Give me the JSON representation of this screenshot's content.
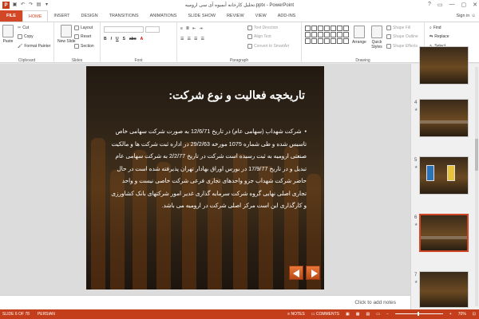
{
  "window": {
    "title": "تحلیل کارخانه آبمیوه آی سی ارومیه.pptx - PowerPoint",
    "app_icon": "P",
    "controls": [
      "?",
      "▭",
      "—",
      "▢",
      "✕"
    ]
  },
  "tabs": [
    {
      "label": "FILE"
    },
    {
      "label": "HOME"
    },
    {
      "label": "INSERT"
    },
    {
      "label": "DESIGN"
    },
    {
      "label": "TRANSITIONS"
    },
    {
      "label": "ANIMATIONS"
    },
    {
      "label": "SLIDE SHOW"
    },
    {
      "label": "REVIEW"
    },
    {
      "label": "VIEW"
    },
    {
      "label": "ADD-INS"
    }
  ],
  "signin": "Sign in",
  "ribbon": {
    "clipboard": {
      "label": "Clipboard",
      "paste": "Paste",
      "cut": "Cut",
      "copy": "Copy",
      "format_painter": "Format Painter"
    },
    "slides": {
      "label": "Slides",
      "new_slide": "New Slide",
      "layout": "Layout",
      "reset": "Reset",
      "section": "Section"
    },
    "font": {
      "label": "Font"
    },
    "paragraph": {
      "label": "Paragraph",
      "text_direction": "Text Direction",
      "align_text": "Align Text",
      "smartart": "Convert to SmartArt"
    },
    "drawing": {
      "label": "Drawing",
      "arrange": "Arrange",
      "quick_styles": "Quick Styles",
      "shape_fill": "Shape Fill",
      "shape_outline": "Shape Outline",
      "shape_effects": "Shape Effects"
    },
    "editing": {
      "label": "Editing",
      "find": "Find",
      "replace": "Replace",
      "select": "Select"
    }
  },
  "slide": {
    "title": "تاریخچه فعالیت و نوع شرکت:",
    "body": "شرکت شهداب (سهامی عام) در تاریخ 12/6/71 به صورت شرکت سهامی خاص تاسیس شده و طی شماره 1075 مورخه 29/2/63 در اداره ثبت شرکت ها و مالکیت صنعتی ارومیه به ثبت رسیده است شرکت در تاریخ 2/2/77 به شرکت سهامی عام تبدیل و در تاریخ 17/9/77 در بورس اوراق بهادار تهران پذیرفته شده است در حال حاضر شرکت شهداب جزو واحدهای تجاری فرعی شرکت خاصی نیست و واحد تجاری اصلی نهایی گروه شرکت سرمایه گذاری غدیر امور شرکتهای بانک کشاورزی و کارگذاری این است مرکز اصلی شرکت در ارومیه می باشد."
  },
  "notes_placeholder": "Click to add notes",
  "thumbnails": [
    {
      "num": "4"
    },
    {
      "num": "5"
    },
    {
      "num": "6"
    },
    {
      "num": "7"
    }
  ],
  "status": {
    "slide_info": "SLIDE 6 OF 78",
    "language": "PERSIAN",
    "notes": "NOTES",
    "comments": "COMMENTS",
    "zoom": "70%"
  },
  "colors": {
    "accent": "#d24726",
    "status": "#c43e1c"
  }
}
